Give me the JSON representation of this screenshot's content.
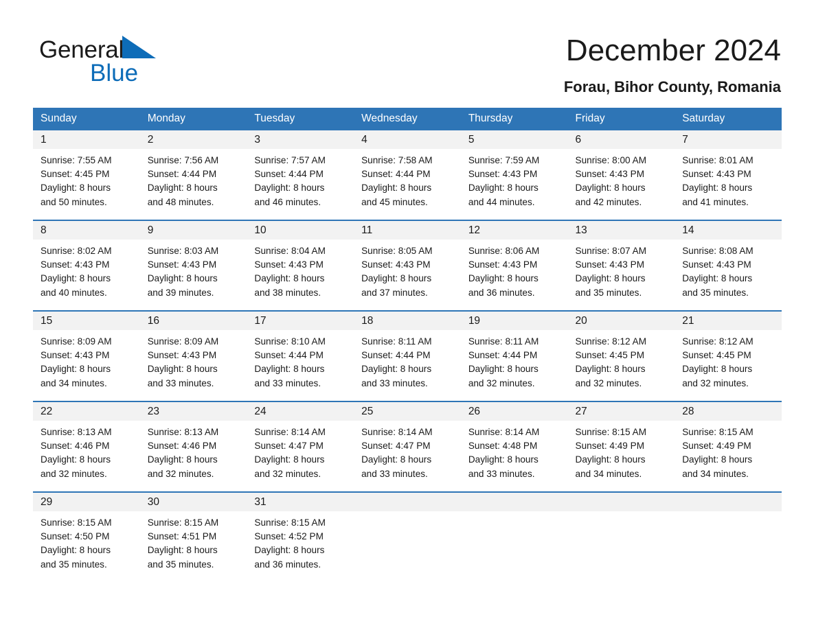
{
  "brand": {
    "name_part1": "General",
    "name_part2": "Blue",
    "logo_icon": "blue-triangle-icon",
    "accent_color": "#0d6cb8"
  },
  "header": {
    "title": "December 2024",
    "subtitle": "Forau, Bihor County, Romania"
  },
  "theme": {
    "header_blue": "#2E75B6",
    "daynum_background": "#F2F2F2",
    "text_color": "#1a1a1a"
  },
  "calendar": {
    "weekday_headers": [
      "Sunday",
      "Monday",
      "Tuesday",
      "Wednesday",
      "Thursday",
      "Friday",
      "Saturday"
    ],
    "weeks": [
      [
        {
          "day": "1",
          "sunrise": "Sunrise: 7:55 AM",
          "sunset": "Sunset: 4:45 PM",
          "daylight_line1": "Daylight: 8 hours",
          "daylight_line2": "and 50 minutes."
        },
        {
          "day": "2",
          "sunrise": "Sunrise: 7:56 AM",
          "sunset": "Sunset: 4:44 PM",
          "daylight_line1": "Daylight: 8 hours",
          "daylight_line2": "and 48 minutes."
        },
        {
          "day": "3",
          "sunrise": "Sunrise: 7:57 AM",
          "sunset": "Sunset: 4:44 PM",
          "daylight_line1": "Daylight: 8 hours",
          "daylight_line2": "and 46 minutes."
        },
        {
          "day": "4",
          "sunrise": "Sunrise: 7:58 AM",
          "sunset": "Sunset: 4:44 PM",
          "daylight_line1": "Daylight: 8 hours",
          "daylight_line2": "and 45 minutes."
        },
        {
          "day": "5",
          "sunrise": "Sunrise: 7:59 AM",
          "sunset": "Sunset: 4:43 PM",
          "daylight_line1": "Daylight: 8 hours",
          "daylight_line2": "and 44 minutes."
        },
        {
          "day": "6",
          "sunrise": "Sunrise: 8:00 AM",
          "sunset": "Sunset: 4:43 PM",
          "daylight_line1": "Daylight: 8 hours",
          "daylight_line2": "and 42 minutes."
        },
        {
          "day": "7",
          "sunrise": "Sunrise: 8:01 AM",
          "sunset": "Sunset: 4:43 PM",
          "daylight_line1": "Daylight: 8 hours",
          "daylight_line2": "and 41 minutes."
        }
      ],
      [
        {
          "day": "8",
          "sunrise": "Sunrise: 8:02 AM",
          "sunset": "Sunset: 4:43 PM",
          "daylight_line1": "Daylight: 8 hours",
          "daylight_line2": "and 40 minutes."
        },
        {
          "day": "9",
          "sunrise": "Sunrise: 8:03 AM",
          "sunset": "Sunset: 4:43 PM",
          "daylight_line1": "Daylight: 8 hours",
          "daylight_line2": "and 39 minutes."
        },
        {
          "day": "10",
          "sunrise": "Sunrise: 8:04 AM",
          "sunset": "Sunset: 4:43 PM",
          "daylight_line1": "Daylight: 8 hours",
          "daylight_line2": "and 38 minutes."
        },
        {
          "day": "11",
          "sunrise": "Sunrise: 8:05 AM",
          "sunset": "Sunset: 4:43 PM",
          "daylight_line1": "Daylight: 8 hours",
          "daylight_line2": "and 37 minutes."
        },
        {
          "day": "12",
          "sunrise": "Sunrise: 8:06 AM",
          "sunset": "Sunset: 4:43 PM",
          "daylight_line1": "Daylight: 8 hours",
          "daylight_line2": "and 36 minutes."
        },
        {
          "day": "13",
          "sunrise": "Sunrise: 8:07 AM",
          "sunset": "Sunset: 4:43 PM",
          "daylight_line1": "Daylight: 8 hours",
          "daylight_line2": "and 35 minutes."
        },
        {
          "day": "14",
          "sunrise": "Sunrise: 8:08 AM",
          "sunset": "Sunset: 4:43 PM",
          "daylight_line1": "Daylight: 8 hours",
          "daylight_line2": "and 35 minutes."
        }
      ],
      [
        {
          "day": "15",
          "sunrise": "Sunrise: 8:09 AM",
          "sunset": "Sunset: 4:43 PM",
          "daylight_line1": "Daylight: 8 hours",
          "daylight_line2": "and 34 minutes."
        },
        {
          "day": "16",
          "sunrise": "Sunrise: 8:09 AM",
          "sunset": "Sunset: 4:43 PM",
          "daylight_line1": "Daylight: 8 hours",
          "daylight_line2": "and 33 minutes."
        },
        {
          "day": "17",
          "sunrise": "Sunrise: 8:10 AM",
          "sunset": "Sunset: 4:44 PM",
          "daylight_line1": "Daylight: 8 hours",
          "daylight_line2": "and 33 minutes."
        },
        {
          "day": "18",
          "sunrise": "Sunrise: 8:11 AM",
          "sunset": "Sunset: 4:44 PM",
          "daylight_line1": "Daylight: 8 hours",
          "daylight_line2": "and 33 minutes."
        },
        {
          "day": "19",
          "sunrise": "Sunrise: 8:11 AM",
          "sunset": "Sunset: 4:44 PM",
          "daylight_line1": "Daylight: 8 hours",
          "daylight_line2": "and 32 minutes."
        },
        {
          "day": "20",
          "sunrise": "Sunrise: 8:12 AM",
          "sunset": "Sunset: 4:45 PM",
          "daylight_line1": "Daylight: 8 hours",
          "daylight_line2": "and 32 minutes."
        },
        {
          "day": "21",
          "sunrise": "Sunrise: 8:12 AM",
          "sunset": "Sunset: 4:45 PM",
          "daylight_line1": "Daylight: 8 hours",
          "daylight_line2": "and 32 minutes."
        }
      ],
      [
        {
          "day": "22",
          "sunrise": "Sunrise: 8:13 AM",
          "sunset": "Sunset: 4:46 PM",
          "daylight_line1": "Daylight: 8 hours",
          "daylight_line2": "and 32 minutes."
        },
        {
          "day": "23",
          "sunrise": "Sunrise: 8:13 AM",
          "sunset": "Sunset: 4:46 PM",
          "daylight_line1": "Daylight: 8 hours",
          "daylight_line2": "and 32 minutes."
        },
        {
          "day": "24",
          "sunrise": "Sunrise: 8:14 AM",
          "sunset": "Sunset: 4:47 PM",
          "daylight_line1": "Daylight: 8 hours",
          "daylight_line2": "and 32 minutes."
        },
        {
          "day": "25",
          "sunrise": "Sunrise: 8:14 AM",
          "sunset": "Sunset: 4:47 PM",
          "daylight_line1": "Daylight: 8 hours",
          "daylight_line2": "and 33 minutes."
        },
        {
          "day": "26",
          "sunrise": "Sunrise: 8:14 AM",
          "sunset": "Sunset: 4:48 PM",
          "daylight_line1": "Daylight: 8 hours",
          "daylight_line2": "and 33 minutes."
        },
        {
          "day": "27",
          "sunrise": "Sunrise: 8:15 AM",
          "sunset": "Sunset: 4:49 PM",
          "daylight_line1": "Daylight: 8 hours",
          "daylight_line2": "and 34 minutes."
        },
        {
          "day": "28",
          "sunrise": "Sunrise: 8:15 AM",
          "sunset": "Sunset: 4:49 PM",
          "daylight_line1": "Daylight: 8 hours",
          "daylight_line2": "and 34 minutes."
        }
      ],
      [
        {
          "day": "29",
          "sunrise": "Sunrise: 8:15 AM",
          "sunset": "Sunset: 4:50 PM",
          "daylight_line1": "Daylight: 8 hours",
          "daylight_line2": "and 35 minutes."
        },
        {
          "day": "30",
          "sunrise": "Sunrise: 8:15 AM",
          "sunset": "Sunset: 4:51 PM",
          "daylight_line1": "Daylight: 8 hours",
          "daylight_line2": "and 35 minutes."
        },
        {
          "day": "31",
          "sunrise": "Sunrise: 8:15 AM",
          "sunset": "Sunset: 4:52 PM",
          "daylight_line1": "Daylight: 8 hours",
          "daylight_line2": "and 36 minutes."
        },
        {
          "day": "",
          "sunrise": "",
          "sunset": "",
          "daylight_line1": "",
          "daylight_line2": ""
        },
        {
          "day": "",
          "sunrise": "",
          "sunset": "",
          "daylight_line1": "",
          "daylight_line2": ""
        },
        {
          "day": "",
          "sunrise": "",
          "sunset": "",
          "daylight_line1": "",
          "daylight_line2": ""
        },
        {
          "day": "",
          "sunrise": "",
          "sunset": "",
          "daylight_line1": "",
          "daylight_line2": ""
        }
      ]
    ]
  }
}
